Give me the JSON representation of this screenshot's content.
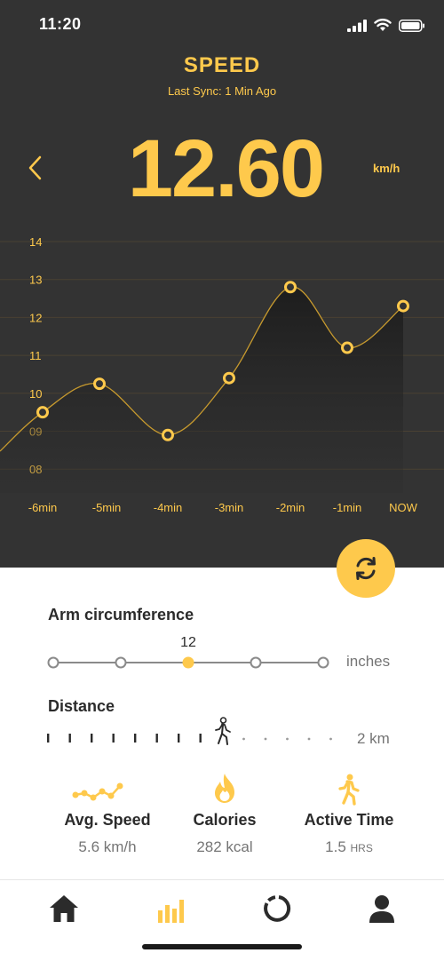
{
  "status_bar": {
    "time": "11:20"
  },
  "header": {
    "title": "SPEED",
    "last_sync": "Last Sync: 1 Min Ago",
    "current_speed": "12.60",
    "unit": "km/h"
  },
  "colors": {
    "accent": "#fec94c",
    "dark_bg": "#333333",
    "text_dark": "#2b2b2b",
    "text_muted": "#757575"
  },
  "chart_data": {
    "type": "line",
    "x": [
      "-6min",
      "-5min",
      "-4min",
      "-3min",
      "-2min",
      "-1min",
      "NOW"
    ],
    "y_ticks": [
      "14",
      "13",
      "12",
      "11",
      "10",
      "09",
      "08"
    ],
    "ylim": [
      8,
      14
    ],
    "series": [
      {
        "values": [
          9.5,
          10.25,
          8.9,
          10.4,
          12.8,
          11.2,
          12.3
        ]
      }
    ],
    "grid": true
  },
  "arm": {
    "label": "Arm circumference",
    "value": "12",
    "unit": "inches",
    "selected_index": 2,
    "stops": 5
  },
  "distance": {
    "label": "Distance",
    "value": "2 km",
    "progress_fraction": 0.6
  },
  "stats": [
    {
      "icon": "trend-line-icon",
      "name": "Avg. Speed",
      "value": "5.6 km/h",
      "suffix": ""
    },
    {
      "icon": "flame-icon",
      "name": "Calories",
      "value": "282 kcal",
      "suffix": ""
    },
    {
      "icon": "walking-person-icon",
      "name": "Active Time",
      "value": "1.5",
      "suffix": "HRS"
    }
  ],
  "nav": {
    "items": [
      "home-icon",
      "stats-bars-icon",
      "progress-ring-icon",
      "profile-icon"
    ],
    "active_index": 1
  }
}
